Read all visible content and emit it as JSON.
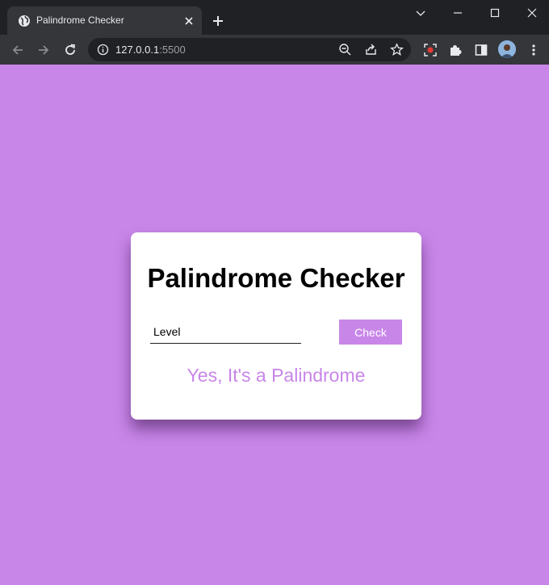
{
  "browser": {
    "tab_title": "Palindrome Checker",
    "url_host": "127.0.0.1",
    "url_port": ":5500"
  },
  "colors": {
    "page_background": "#c886e8",
    "accent": "#c886e8",
    "card_background": "#ffffff",
    "browser_frame": "#202124",
    "browser_toolbar": "#35363a"
  },
  "card": {
    "title": "Palindrome Checker",
    "input_value": "Level",
    "check_label": "Check",
    "result": "Yes, It's a Palindrome"
  }
}
